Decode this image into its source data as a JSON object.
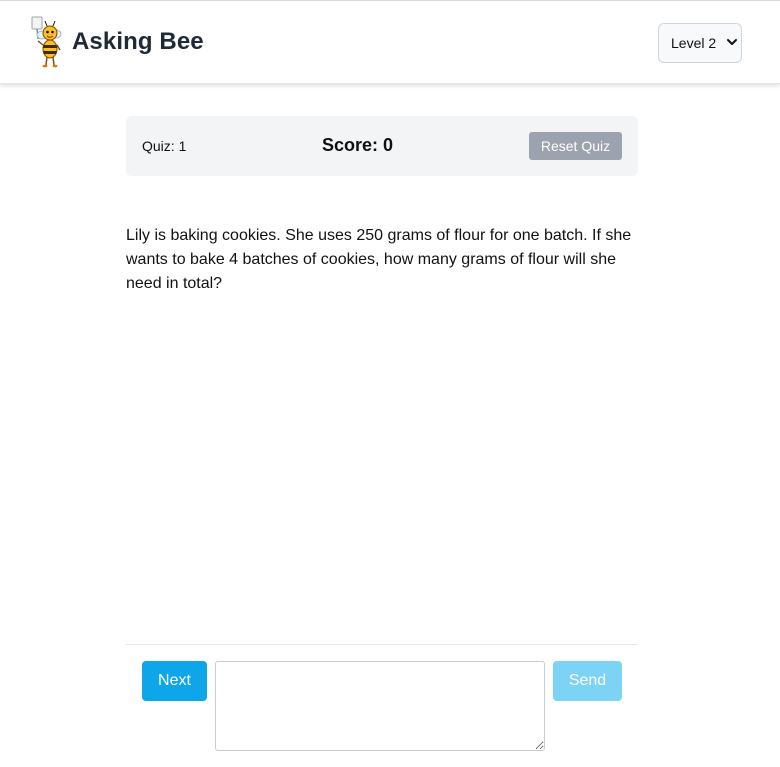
{
  "header": {
    "app_title": "Asking Bee",
    "logo_icon": "bee-mascot-icon",
    "level_select": {
      "selected": "Level 2",
      "icon": "chevron-down-icon"
    }
  },
  "quiz_bar": {
    "quiz_label": "Quiz: 1",
    "score_label": "Score: 0",
    "reset_label": "Reset Quiz"
  },
  "question": {
    "text": "Lily is baking cookies. She uses 250 grams of flour for one batch. If she wants to bake 4 batches of cookies, how many grams of flour will she need in total?"
  },
  "footer": {
    "next_label": "Next",
    "answer_value": "",
    "answer_placeholder": "",
    "send_label": "Send"
  },
  "colors": {
    "next_button": "#0ea5e9",
    "send_button_disabled": "#7dd3f5",
    "reset_button": "#9ca3af",
    "quiz_bar_bg": "#f3f4f6"
  }
}
